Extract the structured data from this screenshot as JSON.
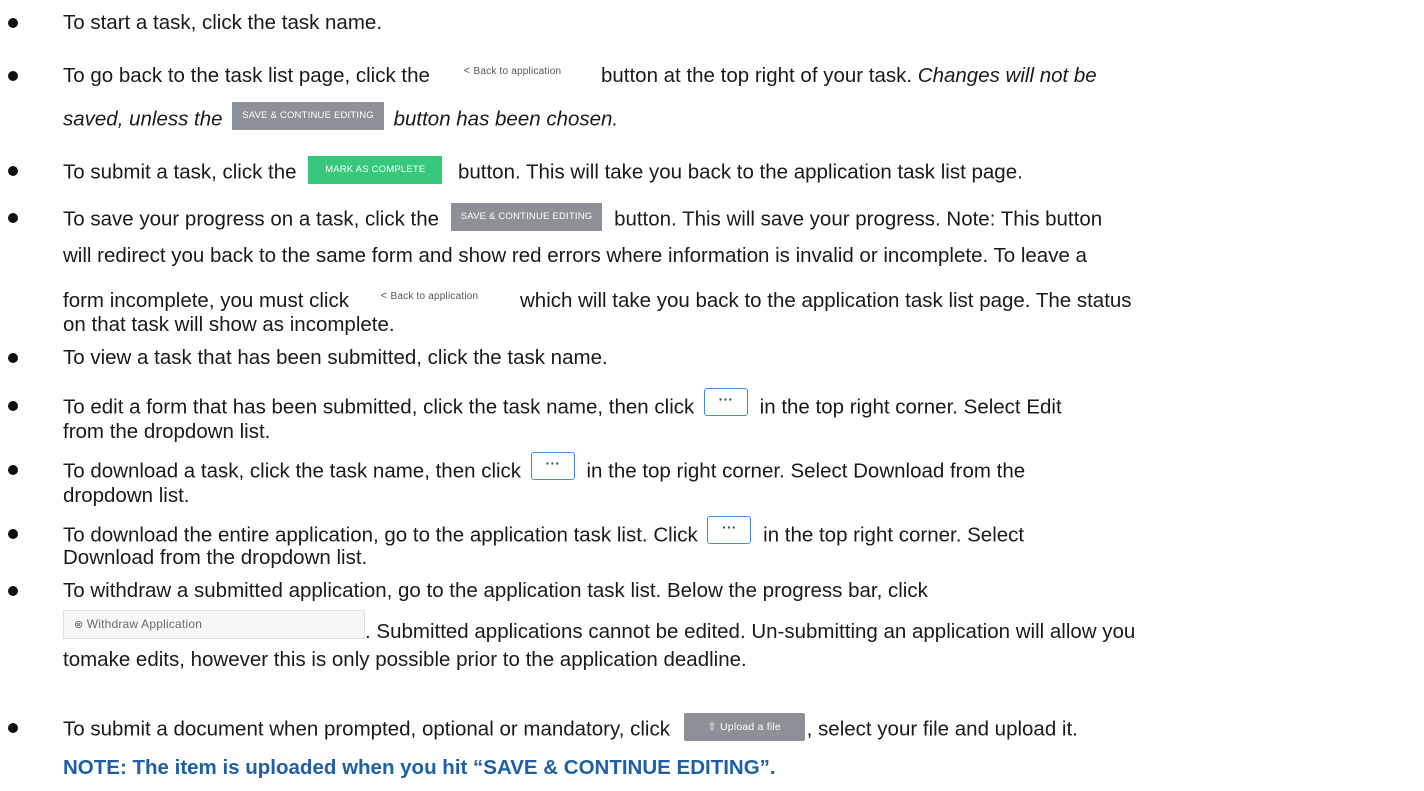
{
  "buttons": {
    "back": "Back to application",
    "back_icon": "chevron-left-icon",
    "save": "SAVE & CONTINUE EDITING",
    "complete": "MARK AS COMPLETE",
    "dots": "···",
    "withdraw": "Withdraw Application",
    "withdraw_icon": "x-circle-icon",
    "upload": "Upload a file",
    "upload_icon": "upload-icon"
  },
  "items": {
    "b1": {
      "t1": "To start a task, click the task name."
    },
    "b2": {
      "t1": "To go back to the task list page, click the",
      "t2": "button at the top right of your task.",
      "t3": "Changes will not be",
      "t4": "saved, unless the",
      "t5": "button has been chosen."
    },
    "b3": {
      "t1": "To submit a task, click the",
      "t2": "button. This will take you back to the application task list page."
    },
    "b4": {
      "t1": "To save your progress on a task, click the",
      "t2": "button. This will save your progress. Note: This button",
      "t3": "will redirect you back to the same form and show red errors where information is invalid or incomplete. To leave a",
      "t4": "form incomplete, you must click",
      "t5": "which will take you back to the application task list page. The status",
      "t6": "on that task will show as incomplete."
    },
    "b5": {
      "t1": "To view a task that has been submitted, click the task name."
    },
    "b6": {
      "t1": "To edit a form that has been submitted, click the task name, then click",
      "t2": "in the top right corner. Select Edit",
      "t3": "from the dropdown list."
    },
    "b7": {
      "t1": "To download a task, click the task name, then click",
      "t2": "in the top right corner. Select Download from the",
      "t3": "dropdown list."
    },
    "b8": {
      "t1": "To download the entire application, go to the application task list. Click",
      "t2": "in the top right corner. Select",
      "t3": "Download from the dropdown list."
    },
    "b9": {
      "t1": "To withdraw a submitted application, go to the application task list. Below the progress bar, click",
      "t2": ". Submitted applications cannot be edited. Un-submitting an application will allow you",
      "t3": "tomake edits, however this is only possible prior to the application deadline."
    },
    "b10": {
      "t1": "To submit a document when prompted, optional or mandatory, click",
      "t2": ", select your file and upload it.",
      "t3": "NOTE:",
      "t4": "The item is uploaded when you hit “SAVE & CONTINUE EDITING”."
    }
  }
}
